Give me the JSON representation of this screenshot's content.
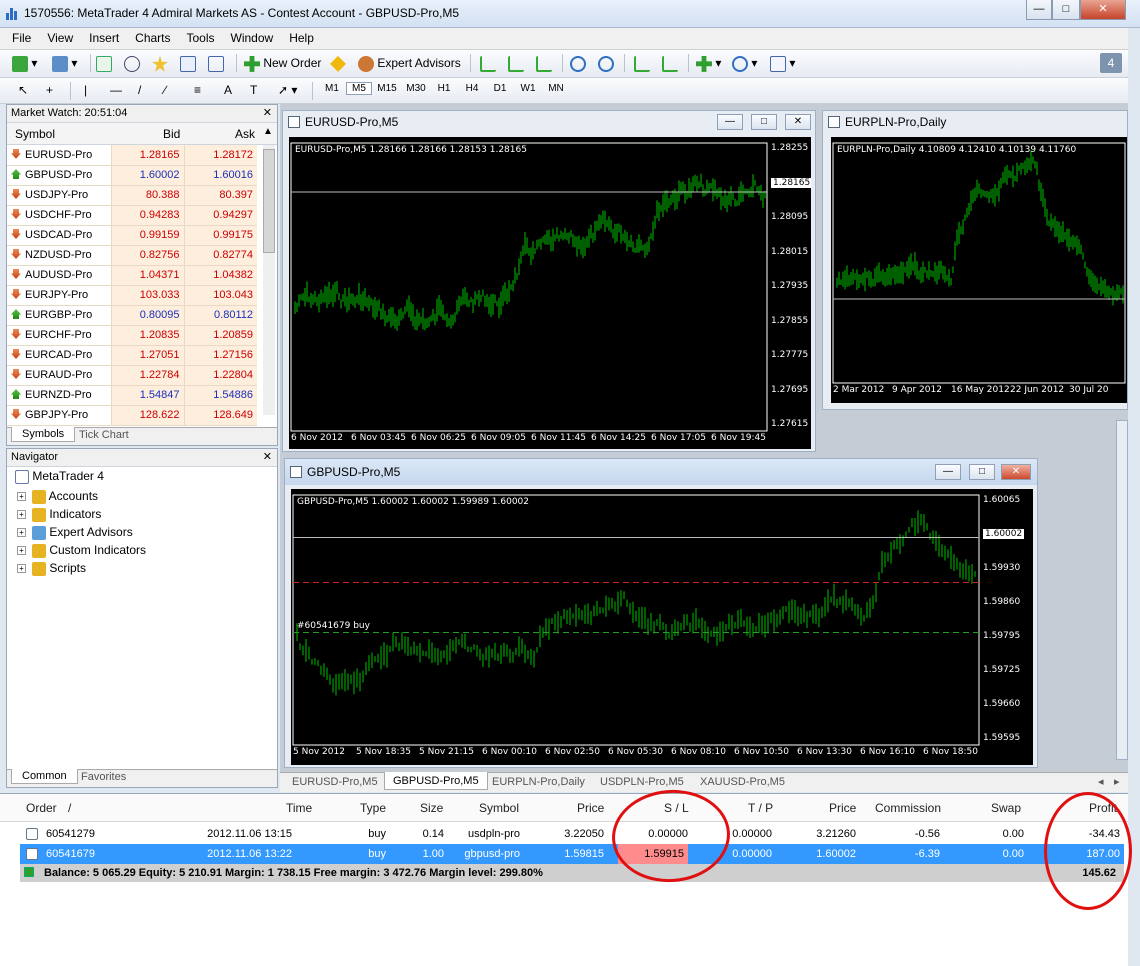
{
  "window": {
    "title": "1570556: MetaTrader 4 Admiral Markets AS - Contest Account - GBPUSD-Pro,M5"
  },
  "menu": [
    "File",
    "View",
    "Insert",
    "Charts",
    "Tools",
    "Window",
    "Help"
  ],
  "toolbar": {
    "new_order": "New Order",
    "expert_advisors": "Expert Advisors",
    "badge": "4",
    "timeframes": [
      "M1",
      "M5",
      "M15",
      "M30",
      "H1",
      "H4",
      "D1",
      "W1",
      "MN"
    ]
  },
  "market_watch": {
    "title": "Market Watch: 20:51:04",
    "col_symbol": "Symbol",
    "col_bid": "Bid",
    "col_ask": "Ask",
    "rows": [
      {
        "symbol": "EURUSD-Pro",
        "bid": "1.28165",
        "ask": "1.28172",
        "dir": "down",
        "color": "red"
      },
      {
        "symbol": "GBPUSD-Pro",
        "bid": "1.60002",
        "ask": "1.60016",
        "dir": "up",
        "color": "blue"
      },
      {
        "symbol": "USDJPY-Pro",
        "bid": "80.388",
        "ask": "80.397",
        "dir": "down",
        "color": "red"
      },
      {
        "symbol": "USDCHF-Pro",
        "bid": "0.94283",
        "ask": "0.94297",
        "dir": "down",
        "color": "red"
      },
      {
        "symbol": "USDCAD-Pro",
        "bid": "0.99159",
        "ask": "0.99175",
        "dir": "down",
        "color": "red"
      },
      {
        "symbol": "NZDUSD-Pro",
        "bid": "0.82756",
        "ask": "0.82774",
        "dir": "down",
        "color": "red"
      },
      {
        "symbol": "AUDUSD-Pro",
        "bid": "1.04371",
        "ask": "1.04382",
        "dir": "down",
        "color": "red"
      },
      {
        "symbol": "EURJPY-Pro",
        "bid": "103.033",
        "ask": "103.043",
        "dir": "down",
        "color": "red"
      },
      {
        "symbol": "EURGBP-Pro",
        "bid": "0.80095",
        "ask": "0.80112",
        "dir": "up",
        "color": "blue"
      },
      {
        "symbol": "EURCHF-Pro",
        "bid": "1.20835",
        "ask": "1.20859",
        "dir": "down",
        "color": "red"
      },
      {
        "symbol": "EURCAD-Pro",
        "bid": "1.27051",
        "ask": "1.27156",
        "dir": "down",
        "color": "red"
      },
      {
        "symbol": "EURAUD-Pro",
        "bid": "1.22784",
        "ask": "1.22804",
        "dir": "down",
        "color": "red"
      },
      {
        "symbol": "EURNZD-Pro",
        "bid": "1.54847",
        "ask": "1.54886",
        "dir": "up",
        "color": "blue"
      },
      {
        "symbol": "GBPJPY-Pro",
        "bid": "128.622",
        "ask": "128.649",
        "dir": "down",
        "color": "red"
      }
    ],
    "tabs": [
      "Symbols",
      "Tick Chart"
    ]
  },
  "navigator": {
    "title": "Navigator",
    "root": "MetaTrader 4",
    "items": [
      "Accounts",
      "Indicators",
      "Expert Advisors",
      "Custom Indicators",
      "Scripts"
    ],
    "tabs": [
      "Common",
      "Favorites"
    ]
  },
  "charts": {
    "eurusd": {
      "title": "EURUSD-Pro,M5",
      "info": "EURUSD-Pro,M5  1.28166 1.28166 1.28153 1.28165",
      "prices": [
        "1.28255",
        "1.28165",
        "1.28095",
        "1.28015",
        "1.27935",
        "1.27855",
        "1.27775",
        "1.27695",
        "1.27615"
      ],
      "current": "1.28165",
      "times": [
        "6 Nov 2012",
        "6 Nov 03:45",
        "6 Nov 06:25",
        "6 Nov 09:05",
        "6 Nov 11:45",
        "6 Nov 14:25",
        "6 Nov 17:05",
        "6 Nov 19:45"
      ]
    },
    "eurpln": {
      "title": "EURPLN-Pro,Daily",
      "info": "EURPLN-Pro,Daily  4.10809 4.12410 4.10139 4.11760",
      "times": [
        "2 Mar 2012",
        "9 Apr 2012",
        "16 May 2012",
        "22 Jun 2012",
        "30 Jul 20"
      ]
    },
    "gbpusd": {
      "title": "GBPUSD-Pro,M5",
      "info": "GBPUSD-Pro,M5  1.60002 1.60002 1.59989 1.60002",
      "order_label": "#60541679 buy",
      "prices": [
        "1.60065",
        "1.60002",
        "1.59930",
        "1.59860",
        "1.59795",
        "1.59725",
        "1.59660",
        "1.59595"
      ],
      "current": "1.60002",
      "times": [
        "5 Nov 2012",
        "5 Nov 18:35",
        "5 Nov 21:15",
        "6 Nov 00:10",
        "6 Nov 02:50",
        "6 Nov 05:30",
        "6 Nov 08:10",
        "6 Nov 10:50",
        "6 Nov 13:30",
        "6 Nov 16:10",
        "6 Nov 18:50"
      ]
    }
  },
  "chart_tabs": [
    "EURUSD-Pro,M5",
    "GBPUSD-Pro,M5",
    "EURPLN-Pro,Daily",
    "USDPLN-Pro,M5",
    "XAUUSD-Pro,M5"
  ],
  "terminal": {
    "headers": [
      "Order",
      "/",
      "Time",
      "Type",
      "Size",
      "Symbol",
      "Price",
      "S / L",
      "T / P",
      "Price",
      "Commission",
      "Swap",
      "Profit"
    ],
    "orders": [
      {
        "order": "60541279",
        "time": "2012.11.06 13:15",
        "type": "buy",
        "size": "0.14",
        "symbol": "usdpln-pro",
        "price": "3.22050",
        "sl": "0.00000",
        "tp": "0.00000",
        "cur_price": "3.21260",
        "commission": "-0.56",
        "swap": "0.00",
        "profit": "-34.43"
      },
      {
        "order": "60541679",
        "time": "2012.11.06 13:22",
        "type": "buy",
        "size": "1.00",
        "symbol": "gbpusd-pro",
        "price": "1.59815",
        "sl": "1.59915",
        "tp": "0.00000",
        "cur_price": "1.60002",
        "commission": "-6.39",
        "swap": "0.00",
        "profit": "187.00"
      }
    ],
    "summary": "Balance: 5 065.29  Equity: 5 210.91  Margin: 1 738.15  Free margin: 3 472.76  Margin level: 299.80%",
    "summary_profit": "145.62"
  },
  "colors": {
    "candle": "#00c000",
    "selected_row": "#3399ff",
    "sl_highlight": "#ff8c8c",
    "annotation": "#e01010"
  }
}
